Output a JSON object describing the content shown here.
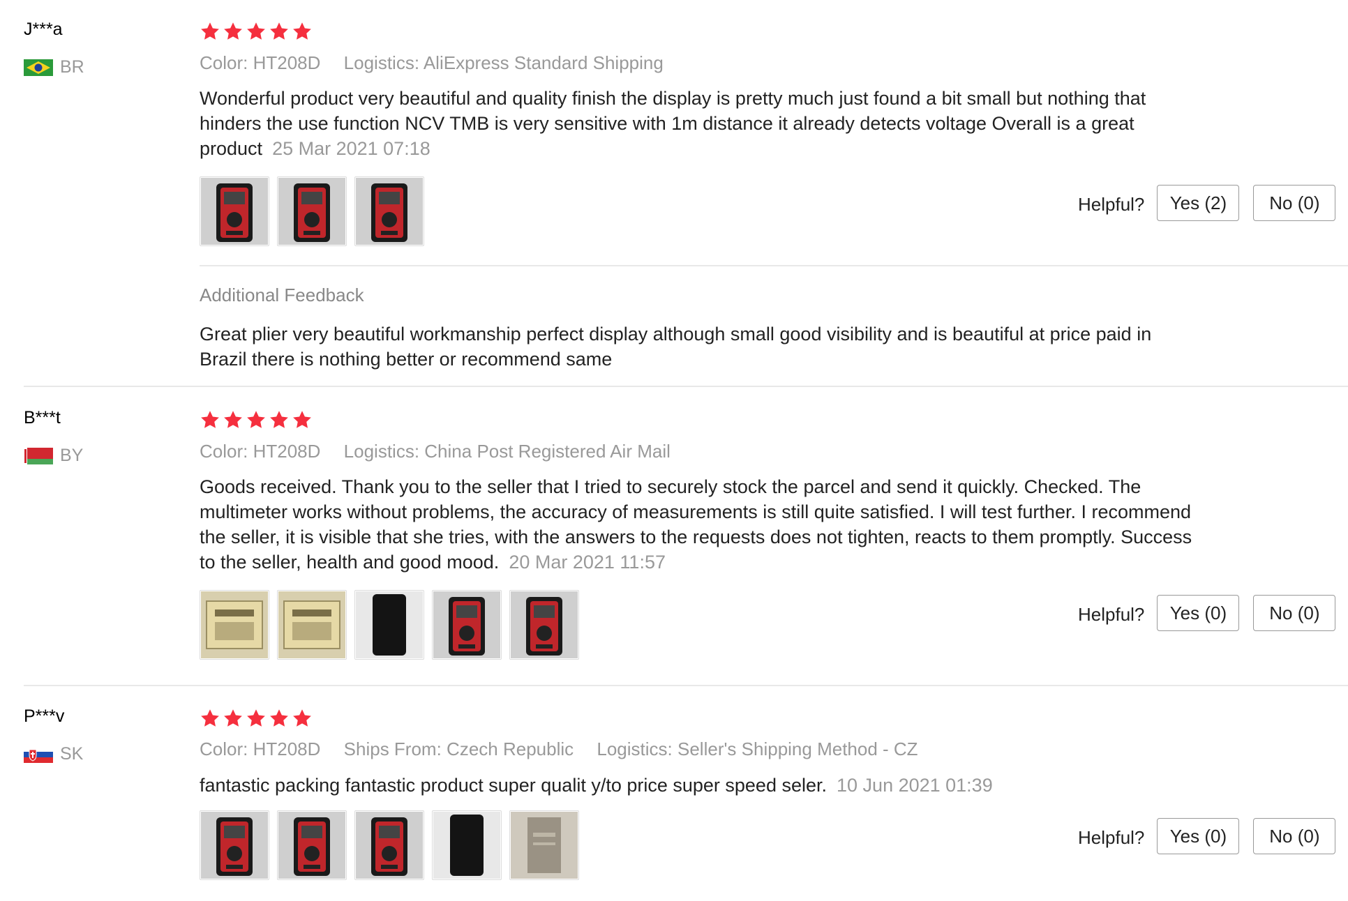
{
  "ui": {
    "labels": {
      "color": "Color:",
      "logistics": "Logistics:",
      "ships_from": "Ships From:",
      "helpful": "Helpful?",
      "additional_feedback": "Additional Feedback"
    },
    "colors": {
      "star": "#f52f3e",
      "divider": "#e8e8e8",
      "muted": "#999999"
    }
  },
  "reviews": [
    {
      "user": "J***a",
      "country": "BR",
      "flag_icon": "brazil-flag-icon",
      "stars": 5,
      "color": "HT208D",
      "logistics": "AliExpress Standard Shipping",
      "text": "Wonderful product very beautiful and quality finish the display is pretty much just found a bit small but nothing that hinders the use function NCV TMB is very sensitive with 1m distance it already detects voltage Overall is a great product",
      "date": "25 Mar 2021 07:18",
      "images": 3,
      "yes": "Yes (2)",
      "no": "No (0)",
      "additional_feedback": "Great plier very beautiful workmanship perfect display although small good visibility and is beautiful at price paid in Brazil there is nothing better or recommend same"
    },
    {
      "user": "B***t",
      "country": "BY",
      "flag_icon": "belarus-flag-icon",
      "stars": 5,
      "color": "HT208D",
      "logistics": "China Post Registered Air Mail",
      "text": "Goods received. Thank you to the seller that I tried to securely stock the parcel and send it quickly. Checked. The multimeter works without problems, the accuracy of measurements is still quite satisfied. I will test further. I recommend the seller, it is visible that she tries, with the answers to the requests does not tighten, reacts to them promptly. Success to the seller, health and good mood.",
      "date": "20 Mar 2021 11:57",
      "images": 5,
      "yes": "Yes (0)",
      "no": "No (0)"
    },
    {
      "user": "P***v",
      "country": "SK",
      "flag_icon": "slovakia-flag-icon",
      "stars": 5,
      "color": "HT208D",
      "ships_from": "Czech Republic",
      "logistics": "Seller's Shipping Method - CZ",
      "text": "fantastic packing fantastic product super qualit y/to price super speed seler.",
      "date": "10 Jun 2021 01:39",
      "images": 5,
      "yes": "Yes (0)",
      "no": "No (0)"
    }
  ]
}
